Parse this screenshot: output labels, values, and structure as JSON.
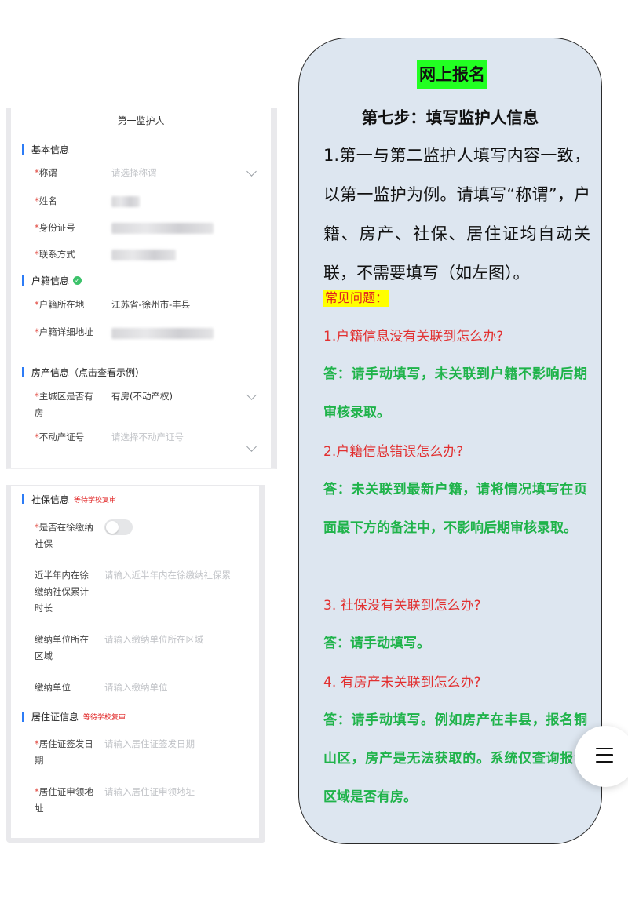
{
  "form_top": {
    "title": "第一监护人",
    "basic": {
      "heading": "基本信息",
      "title_label": "称谓",
      "title_placeholder": "请选择称谓",
      "name_label": "姓名",
      "id_label": "身份证号",
      "contact_label": "联系方式"
    },
    "household": {
      "heading": "户籍信息",
      "location_label": "户籍所在地",
      "location_value": "江苏省-徐州市-丰县",
      "address_label": "户籍详细地址"
    },
    "property": {
      "heading": "房产信息（点击查看示例）",
      "has_house_label": "主城区是否有房",
      "has_house_value": "有房(不动产权)",
      "cert_label": "不动产证号",
      "cert_placeholder": "请选择不动产证号"
    }
  },
  "form_bottom": {
    "social": {
      "heading": "社保信息",
      "badge": "等待学校复审",
      "paying_label": "是否在徐缴纳社保",
      "duration_label": "近半年内在徐缴纳社保累计时长",
      "duration_placeholder": "请输入近半年内在徐缴纳社保累",
      "unit_area_label": "缴纳单位所在区域",
      "unit_area_placeholder": "请输入缴纳单位所在区域",
      "unit_label": "缴纳单位",
      "unit_placeholder": "请输入缴纳单位"
    },
    "residence": {
      "heading": "居住证信息",
      "badge": "等待学校复审",
      "issue_label": "居住证签发日期",
      "issue_placeholder": "请输入居住证签发日期",
      "apply_label": "居住证申领地址",
      "apply_placeholder": "请输入居住证申领地址"
    }
  },
  "card": {
    "headline": "网上报名",
    "step": "第七步：填写监护人信息",
    "intro": "1.第一与第二监护人填写内容一致，以第一监护为例。请填写“称谓”，户籍、房产、社保、居住证均自动关联，不需要填写（如左图）。",
    "faq_tag": "常见问题：",
    "q1": "1.户籍信息没有关联到怎么办?",
    "a1": "答：请手动填写，未关联到户籍不影响后期审核录取。",
    "q2": "2.户籍信息错误怎么办?",
    "a2": "答：未关联到最新户籍，请将情况填写在页面最下方的备注中，不影响后期审核录取。",
    "q3": "3.  社保没有关联到怎么办?",
    "a3": "答：请手动填写。",
    "q4": "4.  有房产未关联到怎么办?",
    "a4": "答：请手动填写。例如房产在丰县，报名铜山区，房产是无法获取的。系统仅查询报名区域是否有房。"
  },
  "icons": {
    "check": "check-circle-icon",
    "menu": "menu-icon",
    "chevron": "chevron-down-icon"
  },
  "colors": {
    "accent": "#2d7cf6",
    "required": "#e0453c",
    "answer": "#1fb34a",
    "question": "#e23030",
    "card_bg": "#dde6f0",
    "headline_bg": "#22ff22"
  }
}
